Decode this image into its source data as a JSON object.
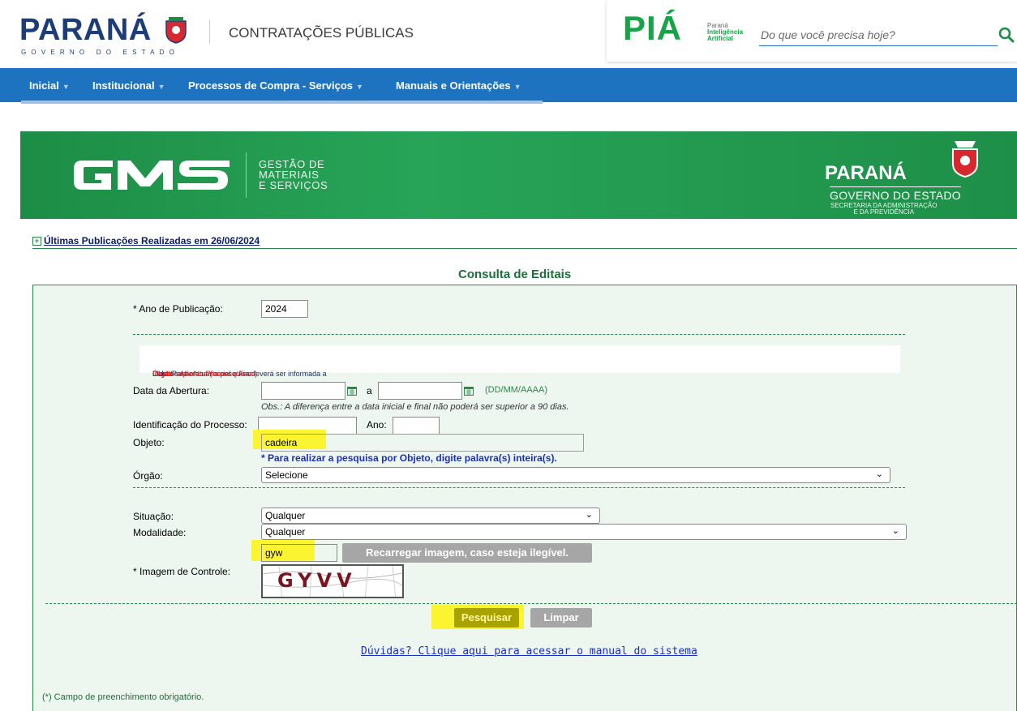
{
  "header": {
    "logo_word": "PARANÁ",
    "logo_sub": "GOVERNO DO ESTADO",
    "site_title": "CONTRATAÇÕES PÚBLICAS",
    "pia_logo": "PIÁ",
    "pia_tag_line1": "Paraná",
    "pia_tag_line2": "Inteligência",
    "pia_tag_line3": "Artificial",
    "search_placeholder": "Do que você precisa hoje?"
  },
  "nav": {
    "items": [
      {
        "label": "Inicial"
      },
      {
        "label": "Institucional"
      },
      {
        "label": "Processos de Compra - Serviços"
      },
      {
        "label": "Manuais e Orientações"
      }
    ],
    "caret": "▼"
  },
  "banner": {
    "gms_line1": "GESTÃO DE",
    "gms_line2": "MATERIAIS",
    "gms_line3": "E SERVIÇOS",
    "parana": "PARANÁ",
    "governo": "GOVERNO DO ESTADO",
    "secretaria_line1": "SECRETARIA DA ADMINISTRAÇÃO",
    "secretaria_line2": "E DA PREVIDÊNCIA"
  },
  "publications_link": "Últimas Publicações Realizadas em 26/06/2024",
  "form": {
    "title": "Consulta de Editais",
    "ano_label": "* Ano de Publicação:",
    "ano_value": "2024",
    "obs_parts": {
      "p1": "Obs.: Para efetuar a pesquisa deverá ser informada a ",
      "p2": "Data de Abertura (Inicial e Final)",
      "p3": " OU ",
      "p4": "Identificação do Processo/Ano",
      "p5": " OU ",
      "p6": "Objeto",
      "p7": " OU ",
      "p8": "Órgão",
      "p9": "."
    },
    "data_abertura_label": "Data da Abertura:",
    "data_a": "a",
    "date_format": "(DD/MM/AAAA)",
    "date_hint": "Obs.: A diferença entre a data inicial e final não poderá ser superior a 90 dias.",
    "processo_label": "Identificação do Processo:",
    "ano_short_label": "Ano:",
    "objeto_label": "Objeto:",
    "objeto_value": "cadeira",
    "objeto_note": "* Para realizar a pesquisa por Objeto, digite palavra(s) inteira(s).",
    "orgao_label": "Órgão:",
    "orgao_value": "Selecione",
    "situacao_label": "Situação:",
    "situacao_value": "Qualquer",
    "modalidade_label": "Modalidade:",
    "modalidade_value": "Qualquer",
    "captcha_input": "gyw",
    "reload_label": "Recarregar imagem, caso esteja ilegível.",
    "imagem_label": "* Imagem de Controle:",
    "captcha_text": "GYVV",
    "search_button": "Pesquisar",
    "clear_button": "Limpar",
    "help_link": "Dúvidas? Clique aqui para acessar o manual do sistema",
    "required_note": "(*) Campo de preenchimento obrigatório."
  },
  "colors": {
    "nav_blue": "#1e73c0",
    "green": "#2a8a4a",
    "highlight": "#fbf431"
  }
}
